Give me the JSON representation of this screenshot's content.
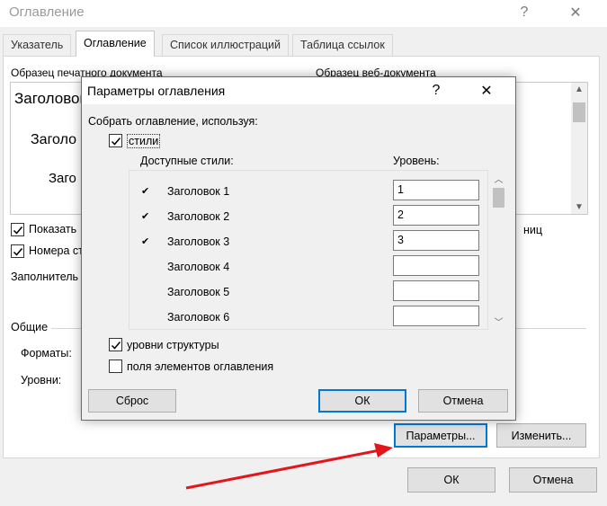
{
  "main_window": {
    "title": "Оглавление",
    "help_glyph": "?",
    "close_glyph": "✕",
    "tabs": [
      {
        "label": "Указатель"
      },
      {
        "label": "Оглавление"
      },
      {
        "label": "Список иллюстраций"
      },
      {
        "label": "Таблица ссылок"
      }
    ],
    "print_preview": {
      "label": "Образец печатного документа",
      "lines": [
        "Заголовок",
        "Заголо",
        "Заго"
      ]
    },
    "web_preview": {
      "label": "Образец веб-документа"
    },
    "show_page_numbers": {
      "label": "Показать",
      "checked": true
    },
    "page_numbers_right": {
      "label": "Номера ст",
      "checked": true
    },
    "hyperlinks_tail": "ниц",
    "tab_leader_label": "Заполнитель",
    "general_label": "Общие",
    "formats_label": "Форматы:",
    "levels_label": "Уровни:",
    "options_button": "Параметры...",
    "modify_button": "Изменить...",
    "ok_button": "ОК",
    "cancel_button": "Отмена"
  },
  "dialog": {
    "title": "Параметры оглавления",
    "help_glyph": "?",
    "close_glyph": "✕",
    "build_from_label": "Собрать оглавление, используя:",
    "styles_checkbox": {
      "label": "стили",
      "checked": true
    },
    "available_styles_header": "Доступные стили:",
    "level_header": "Уровень:",
    "styles": [
      {
        "name": "Заголовок 1",
        "checked": true,
        "level": "1"
      },
      {
        "name": "Заголовок 2",
        "checked": true,
        "level": "2"
      },
      {
        "name": "Заголовок 3",
        "checked": true,
        "level": "3"
      },
      {
        "name": "Заголовок 4",
        "checked": false,
        "level": ""
      },
      {
        "name": "Заголовок 5",
        "checked": false,
        "level": ""
      },
      {
        "name": "Заголовок 6",
        "checked": false,
        "level": ""
      }
    ],
    "outline_levels": {
      "label": "уровни структуры",
      "checked": true
    },
    "table_entry_fields": {
      "label": "поля элементов оглавления",
      "checked": false
    },
    "reset_button": "Сброс",
    "ok_button": "ОК",
    "cancel_button": "Отмена"
  },
  "colors": {
    "arrow": "#e3161b",
    "focus": "#0078d7"
  }
}
